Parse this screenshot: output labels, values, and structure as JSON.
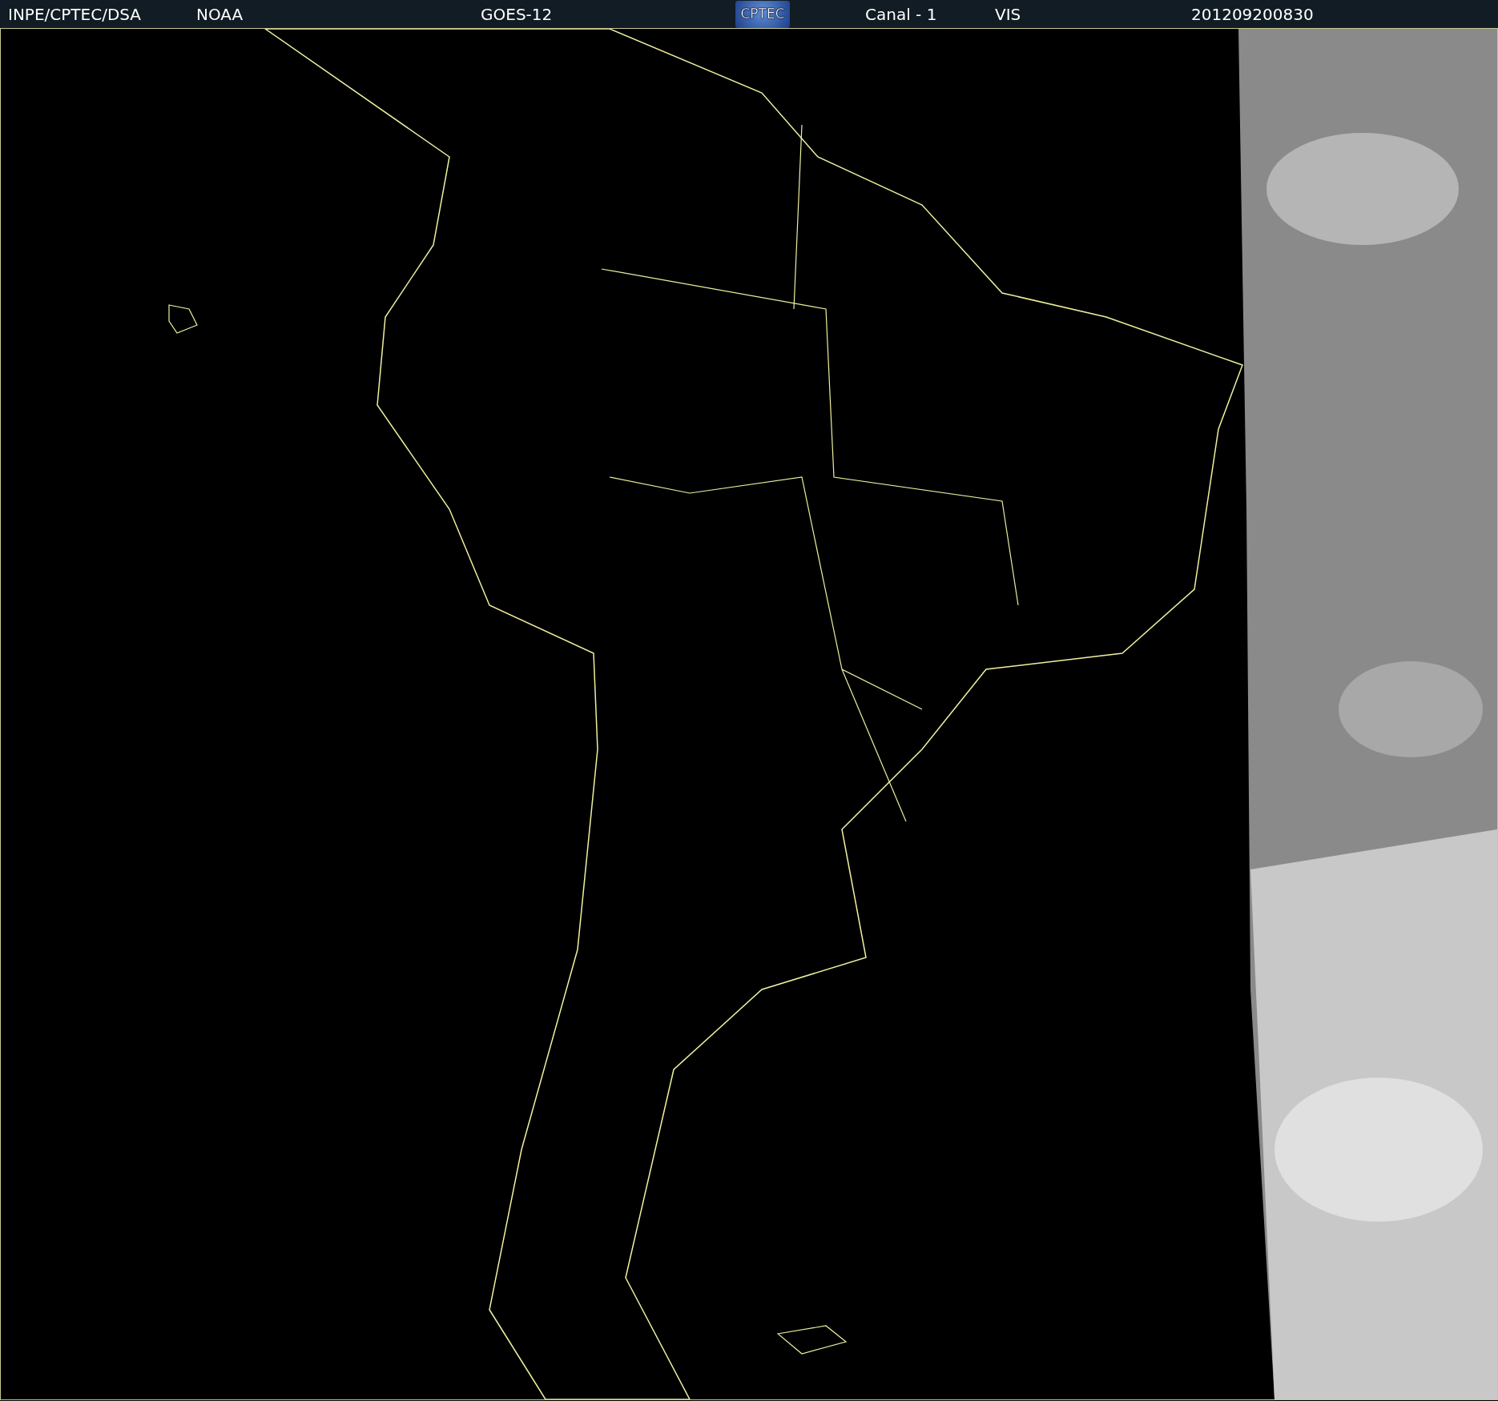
{
  "header": {
    "items": [
      {
        "kind": "text",
        "text": "INPE/CPTEC/DSA"
      },
      {
        "kind": "text",
        "text": "NOAA"
      },
      {
        "kind": "text",
        "text": "GOES-12"
      },
      {
        "kind": "logo",
        "text": "CPTEC"
      },
      {
        "kind": "text",
        "text": "Canal - 1"
      },
      {
        "kind": "text",
        "text": "VIS"
      },
      {
        "kind": "text",
        "text": "201209200830"
      }
    ]
  }
}
